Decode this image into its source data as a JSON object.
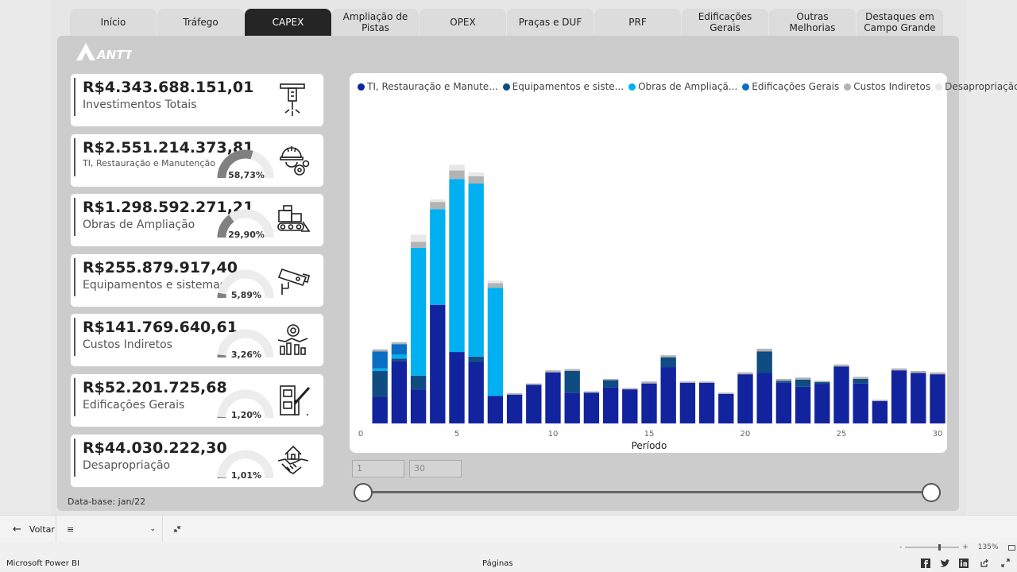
{
  "tabs": [
    {
      "label": "Início",
      "active": false
    },
    {
      "label": "Tráfego",
      "active": false
    },
    {
      "label": "CAPEX",
      "active": true
    },
    {
      "label": "Ampliação de Pistas",
      "active": false
    },
    {
      "label": "OPEX",
      "active": false
    },
    {
      "label": "Praças e DUF",
      "active": false
    },
    {
      "label": "PRF",
      "active": false
    },
    {
      "label": "Edificações Gerais",
      "active": false
    },
    {
      "label": "Outras Melhorias",
      "active": false
    },
    {
      "label": "Destaques em Campo Grande",
      "active": false
    }
  ],
  "logo": {
    "text": "ANTT"
  },
  "kpis": [
    {
      "value": "R$4.343.688.151,01",
      "label": "Investimentos Totais",
      "icon": "jackhammer-icon"
    },
    {
      "value": "R$2.551.214.373,81",
      "label": "TI, Restauração e Manutenção",
      "percent": "58,73%",
      "fraction": 0.5873,
      "icon": "worker-gear-icon"
    },
    {
      "value": "R$1.298.592.271,21",
      "label": "Obras de Ampliação",
      "percent": "29,90%",
      "fraction": 0.299,
      "icon": "bulldozer-icon"
    },
    {
      "value": "R$255.879.917,40",
      "label": "Equipamentos e sistemas",
      "percent": "5,89%",
      "fraction": 0.0589,
      "icon": "security-camera-icon"
    },
    {
      "value": "R$141.769.640,61",
      "label": "Custos Indiretos",
      "percent": "3,26%",
      "fraction": 0.0326,
      "icon": "gear-network-icon"
    },
    {
      "value": "R$52.201.725,68",
      "label": "Edificações Gerais",
      "percent": "1,20%",
      "fraction": 0.012,
      "icon": "toll-booth-icon"
    },
    {
      "value": "R$44.030.222,30",
      "label": "Desapropriação",
      "percent": "1,01%",
      "fraction": 0.0101,
      "icon": "handshake-house-icon"
    }
  ],
  "database_label": "Data-base: jan/22",
  "slicer": {
    "min": "1",
    "max": "30"
  },
  "nav": {
    "back": "Voltar"
  },
  "status": {
    "brand": "Microsoft Power BI",
    "pages": "Páginas",
    "zoom": "135%"
  },
  "colors": {
    "ti": "#12239e",
    "equip": "#0f4c81",
    "obras": "#00b0f0",
    "edif": "#0a6fc2",
    "custos": "#b3b3b3",
    "desap": "#e8e8e8"
  },
  "chart_data": {
    "type": "bar",
    "stacked": true,
    "xlabel": "Período",
    "xlim": [
      0,
      30
    ],
    "xticks": [
      0,
      5,
      10,
      15,
      20,
      25,
      30
    ],
    "legend_position": "top",
    "x": [
      1,
      2,
      3,
      4,
      5,
      6,
      7,
      8,
      9,
      10,
      11,
      12,
      13,
      14,
      15,
      16,
      17,
      18,
      19,
      20,
      21,
      22,
      23,
      24,
      25,
      26,
      27,
      28,
      29,
      30
    ],
    "series": [
      {
        "name": "TI, Restauração e Manute...",
        "color": "#12239e",
        "values": [
          40,
          95,
          52,
          181,
          109,
          94,
          42,
          44,
          59,
          78,
          47,
          47,
          55,
          52,
          61,
          86,
          62,
          62,
          45,
          75,
          77,
          62,
          56,
          60,
          87,
          61,
          34,
          81,
          77,
          75
        ]
      },
      {
        "name": "Equipamentos e siste...",
        "color": "#0f4c81",
        "values": [
          40,
          4,
          21,
          0,
          0,
          8,
          0,
          0,
          0,
          0,
          33,
          0,
          11,
          0,
          0,
          15,
          0,
          0,
          0,
          0,
          33,
          3,
          11,
          3,
          0,
          7,
          0,
          0,
          0,
          0
        ]
      },
      {
        "name": "Obras de Ampliaçã...",
        "color": "#00b0f0",
        "values": [
          4,
          6,
          195,
          146,
          264,
          264,
          165,
          0,
          0,
          0,
          0,
          0,
          0,
          0,
          0,
          0,
          0,
          0,
          0,
          0,
          0,
          0,
          0,
          0,
          0,
          0,
          0,
          0,
          0,
          0
        ]
      },
      {
        "name": "Edificações Gerais",
        "color": "#0a6fc2",
        "values": [
          26,
          16,
          0,
          0,
          0,
          0,
          0,
          0,
          0,
          0,
          0,
          0,
          0,
          0,
          0,
          0,
          0,
          0,
          0,
          0,
          0,
          0,
          0,
          0,
          0,
          0,
          0,
          0,
          0,
          0
        ]
      },
      {
        "name": "Custos Indiretos",
        "color": "#b3b3b3",
        "values": [
          3,
          3,
          9,
          11,
          13,
          11,
          7,
          2,
          2,
          3,
          3,
          2,
          2,
          2,
          3,
          3,
          2,
          2,
          2,
          3,
          4,
          3,
          3,
          2,
          3,
          3,
          2,
          3,
          3,
          3
        ]
      },
      {
        "name": "Desapropriação",
        "color": "#e8e8e8",
        "values": [
          0,
          0,
          11,
          4,
          9,
          6,
          4,
          0,
          0,
          0,
          0,
          0,
          0,
          0,
          0,
          0,
          0,
          0,
          0,
          0,
          0,
          0,
          0,
          0,
          0,
          0,
          0,
          0,
          0,
          0
        ]
      }
    ]
  }
}
